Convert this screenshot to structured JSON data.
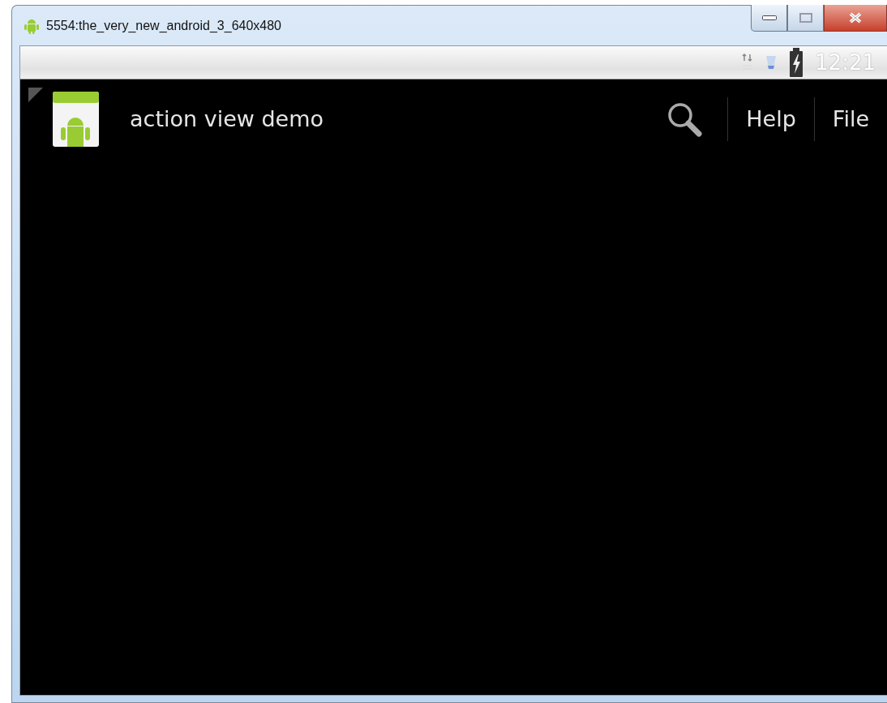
{
  "window": {
    "title": "5554:the_very_new_android_3_640x480"
  },
  "status_bar": {
    "clock": "12:21"
  },
  "action_bar": {
    "title": "action view demo",
    "items": [
      {
        "kind": "search"
      },
      {
        "kind": "text",
        "label": "Help"
      },
      {
        "kind": "text",
        "label": "File"
      }
    ]
  }
}
